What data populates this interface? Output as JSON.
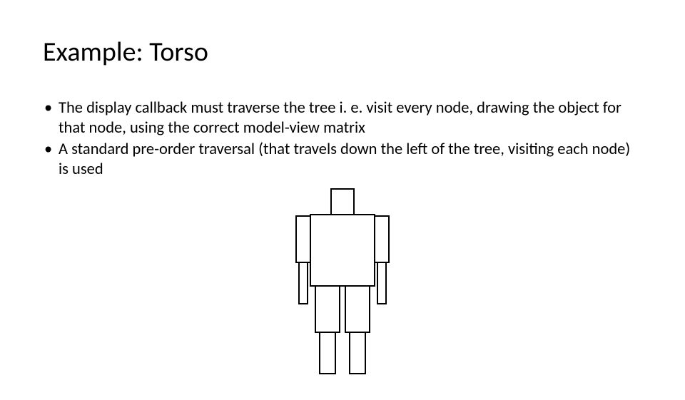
{
  "slide": {
    "title": "Example: Torso",
    "bullets": [
      "The display callback must traverse the tree i. e. visit every node, drawing the object for that node, using the correct model-view matrix",
      "A standard pre-order traversal (that travels down the left of the tree, visiting each node) is used"
    ]
  },
  "figure": {
    "name": "robot-figure-icon",
    "description": "A blocky humanoid robot figure composed of rectangles: head, torso, two upper arms, two lower arms, two upper legs, two lower legs."
  }
}
